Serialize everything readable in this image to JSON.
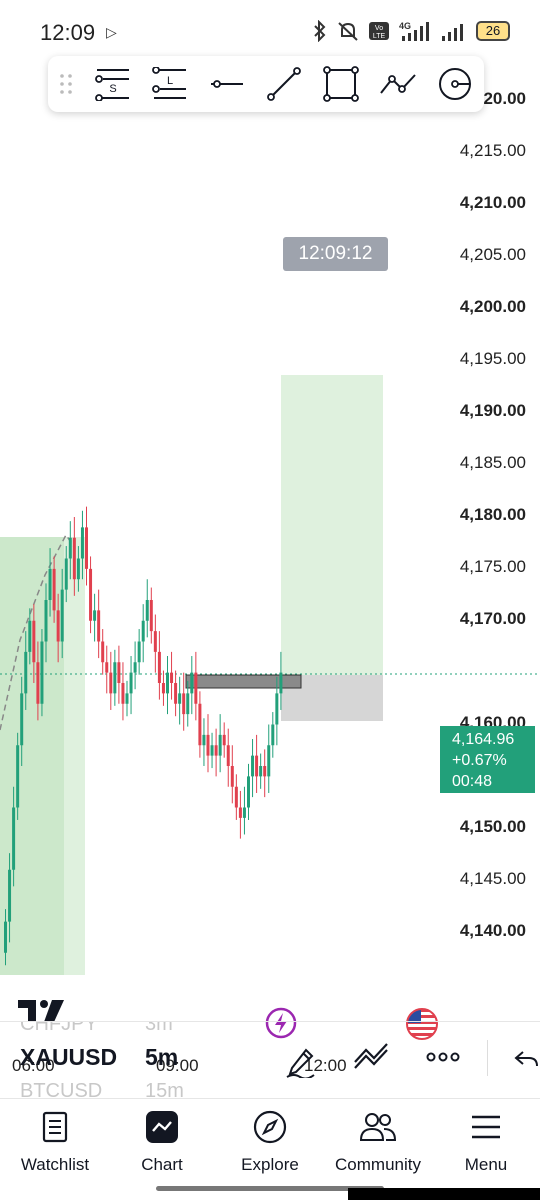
{
  "status_bar": {
    "time": "12:09",
    "lte_label": "Vo LTE",
    "network_label": "4G",
    "battery": "26"
  },
  "drawing_toolbar": {
    "tools": [
      "drag-handle",
      "short-position",
      "long-position",
      "horizontal-line",
      "trend-line",
      "rectangle",
      "path",
      "circle-point"
    ],
    "short_label": "S",
    "long_label": "L"
  },
  "chart": {
    "symbol": "XAUUSD",
    "interval": "5m",
    "crosshair_time": "12:09:12",
    "price_axis": [
      {
        "label": "4,220.00",
        "bold": true
      },
      {
        "label": "4,215.00",
        "bold": false
      },
      {
        "label": "4,210.00",
        "bold": true
      },
      {
        "label": "4,205.00",
        "bold": false
      },
      {
        "label": "4,200.00",
        "bold": true
      },
      {
        "label": "4,195.00",
        "bold": false
      },
      {
        "label": "4,190.00",
        "bold": true
      },
      {
        "label": "4,185.00",
        "bold": false
      },
      {
        "label": "4,180.00",
        "bold": true
      },
      {
        "label": "4,175.00",
        "bold": false
      },
      {
        "label": "4,170.00",
        "bold": true
      },
      {
        "label": "4,160.00",
        "bold": true
      },
      {
        "label": "4,155.00",
        "bold": false
      },
      {
        "label": "4,150.00",
        "bold": true
      },
      {
        "label": "4,145.00",
        "bold": false
      },
      {
        "label": "4,140.00",
        "bold": true
      }
    ],
    "time_axis": [
      "06:00",
      "09:00",
      "12:00"
    ],
    "current_price": "4,164.96",
    "change_pct": "+0.67%",
    "countdown": "00:48",
    "colors": {
      "up": "#22a07a",
      "down": "#e0404e",
      "profit_zone": "#dff1de",
      "loss_zone": "#d6d6d6",
      "tooltip": "#9ea3ad"
    }
  },
  "symbol_bar": {
    "prev_symbol": "CHFJPY",
    "prev_interval": "3m",
    "next_symbol": "BTCUSD",
    "next_interval": "15m"
  },
  "bottom_nav": {
    "items": [
      {
        "label": "Watchlist",
        "icon": "watchlist-icon"
      },
      {
        "label": "Chart",
        "icon": "chart-icon"
      },
      {
        "label": "Explore",
        "icon": "compass-icon"
      },
      {
        "label": "Community",
        "icon": "community-icon"
      },
      {
        "label": "Menu",
        "icon": "menu-icon"
      }
    ]
  }
}
